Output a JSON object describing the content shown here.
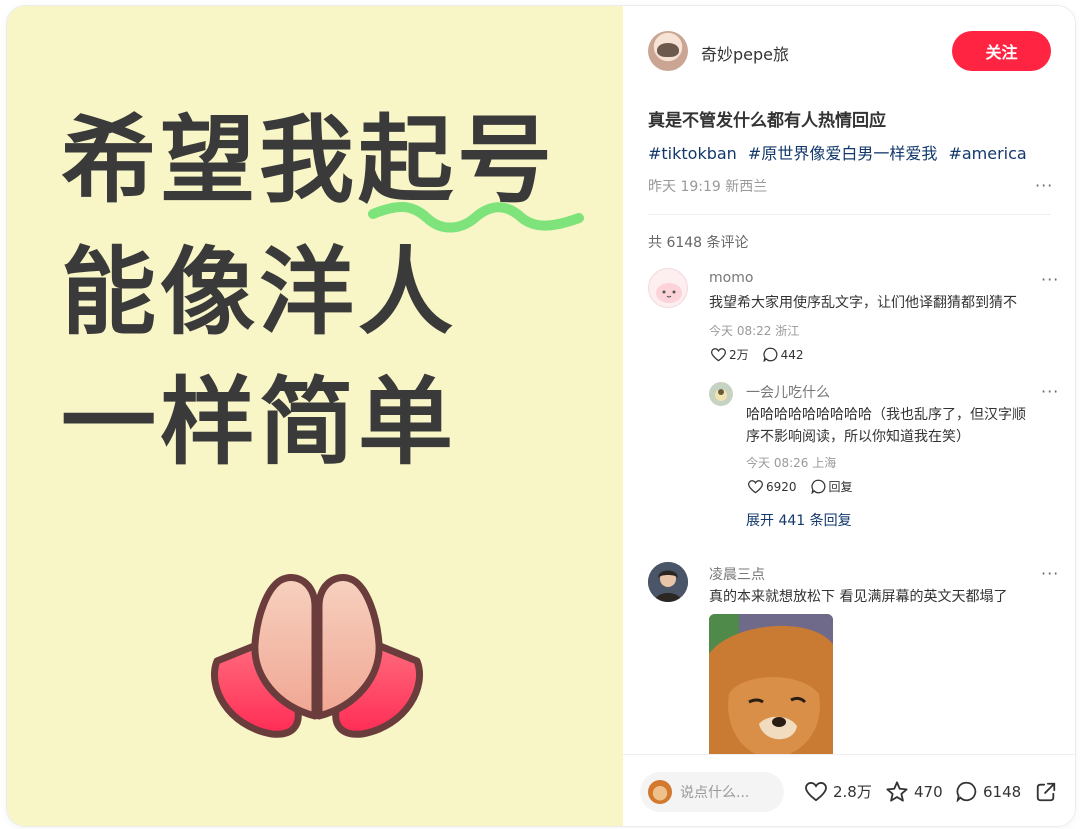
{
  "image": {
    "lines": [
      "希望我起号",
      "能像洋人",
      "一样简单"
    ]
  },
  "author": {
    "name": "奇妙pepe旅",
    "follow_label": "关注"
  },
  "post": {
    "title": "真是不管发什么都有人热情回应",
    "tags": [
      "#tiktokban",
      "#原世界像爱白男一样爱我",
      "#america"
    ],
    "meta": "昨天 19:19 新西兰"
  },
  "comments_total": "共 6148 条评论",
  "comments": [
    {
      "name": "momo",
      "text": "我望希大家用使序乱文字，让们他译翻猜都到猜不",
      "meta": "今天 08:22 浙江",
      "likes": "2万",
      "replies": "442",
      "sub": {
        "name": "一会儿吃什么",
        "text_line1": "哈哈哈哈哈哈哈哈哈（我也乱序了，但汉字顺",
        "text_line2": "序不影响阅读，所以你知道我在笑）",
        "meta": "今天 08:26 上海",
        "likes": "6920",
        "reply_label": "回复"
      },
      "expand_label": "展开 441 条回复"
    },
    {
      "name": "凌晨三点",
      "text": "真的本来就想放松下 看见满屏幕的英文天都塌了"
    }
  ],
  "bottom_bar": {
    "input_placeholder": "说点什么...",
    "likes": "2.8万",
    "collects": "470",
    "comments": "6148"
  },
  "more_label": "···",
  "colors": {
    "accent": "#ff2442",
    "tag_link": "#13386c",
    "image_bg": "#f8f5c6"
  }
}
